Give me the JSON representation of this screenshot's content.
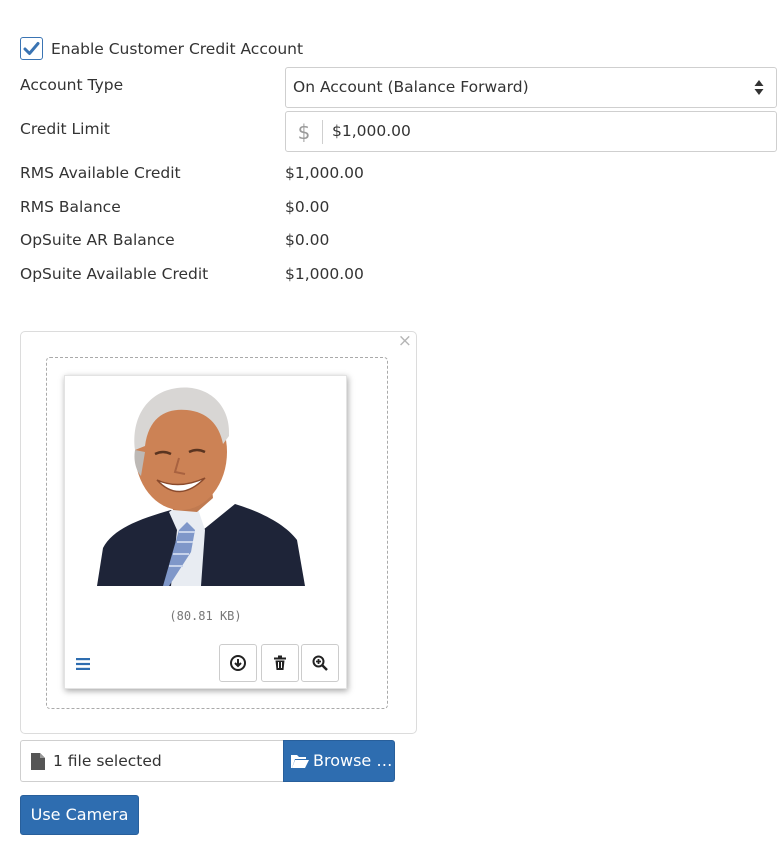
{
  "credit_account": {
    "enable_label": "Enable Customer Credit Account",
    "enabled": true
  },
  "fields": {
    "account_type_label": "Account Type",
    "account_type_value": "On Account (Balance Forward)",
    "credit_limit_label": "Credit Limit",
    "credit_limit_currency": "$",
    "credit_limit_value": "$1,000.00"
  },
  "summary": {
    "rms_available_credit_label": "RMS Available Credit",
    "rms_available_credit_value": "$1,000.00",
    "rms_balance_label": "RMS Balance",
    "rms_balance_value": "$0.00",
    "opsuite_ar_balance_label": "OpSuite AR Balance",
    "opsuite_ar_balance_value": "$0.00",
    "opsuite_available_credit_label": "OpSuite Available Credit",
    "opsuite_available_credit_value": "$1,000.00"
  },
  "upload": {
    "close_glyph": "×",
    "file_size": "(80.81 KB)",
    "caption": "1 file selected",
    "browse_label": "Browse …",
    "camera_label": "Use Camera"
  },
  "icons": {
    "checkbox": "check-icon",
    "select": "sort-arrows-icon",
    "drag": "drag-handle-icon",
    "download": "download-icon",
    "delete": "trash-icon",
    "zoom": "zoom-in-icon",
    "file": "file-icon",
    "folder": "folder-open-icon"
  },
  "colors": {
    "primary": "#2e6db0",
    "check": "#3a74b3",
    "border": "#cfcfcf"
  }
}
